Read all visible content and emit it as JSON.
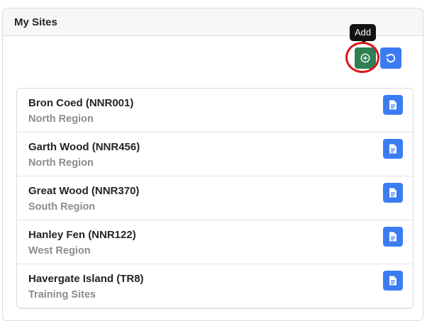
{
  "panel": {
    "title": "My Sites"
  },
  "toolbar": {
    "add_tooltip": "Add",
    "add_icon": "plus-circle-icon",
    "refresh_icon": "refresh-icon"
  },
  "colors": {
    "add_button": "#2f7f53",
    "primary_button": "#3b7cf3",
    "highlight_ring": "#d7191c"
  },
  "sites": [
    {
      "name": "Bron Coed (NNR001)",
      "region": "North Region"
    },
    {
      "name": "Garth Wood (NNR456)",
      "region": "North Region"
    },
    {
      "name": "Great Wood (NNR370)",
      "region": "South Region"
    },
    {
      "name": "Hanley Fen (NNR122)",
      "region": "West Region"
    },
    {
      "name": "Havergate Island (TR8)",
      "region": "Training Sites"
    }
  ]
}
